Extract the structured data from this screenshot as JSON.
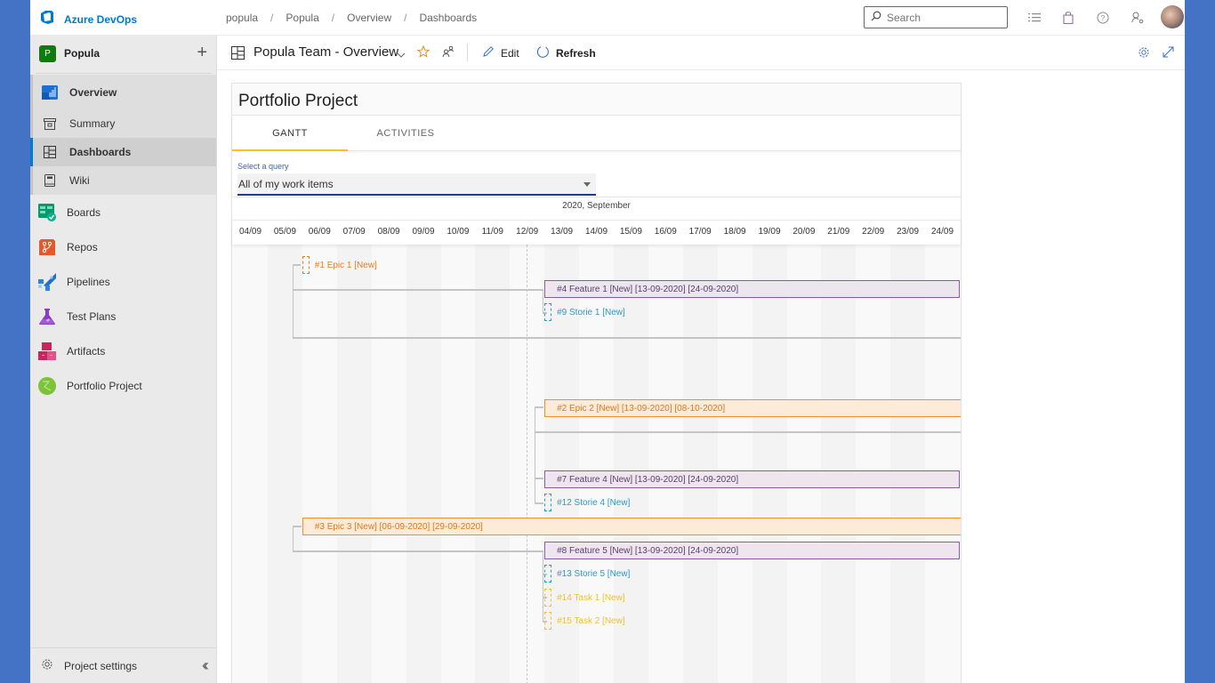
{
  "app": {
    "brand": "Azure DevOps",
    "accent": "#0078d4"
  },
  "breadcrumb": [
    "popula",
    "Popula",
    "Overview",
    "Dashboards"
  ],
  "search": {
    "placeholder": "Search"
  },
  "topbar_icons": [
    "list-icon",
    "shopping-bag-icon",
    "help-icon",
    "user-settings-icon"
  ],
  "sidebar": {
    "project": {
      "initial": "P",
      "name": "Popula",
      "color": "#107c10"
    },
    "overview_group": [
      {
        "label": "Overview",
        "icon": "overview-icon"
      },
      {
        "label": "Summary",
        "icon": "summary-icon"
      },
      {
        "label": "Dashboards",
        "icon": "dashboards-icon",
        "active": true
      },
      {
        "label": "Wiki",
        "icon": "wiki-icon"
      }
    ],
    "items": [
      {
        "label": "Boards",
        "icon": "boards-icon"
      },
      {
        "label": "Repos",
        "icon": "repos-icon"
      },
      {
        "label": "Pipelines",
        "icon": "pipelines-icon"
      },
      {
        "label": "Test Plans",
        "icon": "test-plans-icon"
      },
      {
        "label": "Artifacts",
        "icon": "artifacts-icon"
      },
      {
        "label": "Portfolio Project",
        "icon": "portfolio-icon"
      }
    ],
    "footer": {
      "label": "Project settings"
    }
  },
  "dashboard": {
    "title": "Popula Team - Overview",
    "edit_label": "Edit",
    "refresh_label": "Refresh"
  },
  "widget": {
    "title": "Portfolio Project",
    "tabs": [
      {
        "label": "GANTT",
        "active": true
      },
      {
        "label": "ACTIVITIES",
        "active": false
      }
    ],
    "query": {
      "label": "Select a query",
      "value": "All of my work items"
    },
    "gantt": {
      "month": "2020, September",
      "days": [
        "04/09",
        "05/09",
        "06/09",
        "07/09",
        "08/09",
        "09/09",
        "10/09",
        "11/09",
        "12/09",
        "13/09",
        "14/09",
        "15/09",
        "16/09",
        "17/09",
        "18/09",
        "19/09",
        "20/09",
        "21/09",
        "22/09",
        "23/09",
        "24/09"
      ],
      "today": "12/09",
      "items": [
        {
          "label": "#1 Epic 1 [New]",
          "type": "epic",
          "kind": "milestone",
          "start": "06/09"
        },
        {
          "label": "#4 Feature 1 [New] [13-09-2020] [24-09-2020]",
          "type": "feature",
          "kind": "bar",
          "start": "13/09",
          "end": "24/09"
        },
        {
          "label": "#9 Storie 1 [New]",
          "type": "story",
          "kind": "milestone",
          "start": "13/09"
        },
        {
          "label": "#2 Epic 2 [New] [13-09-2020] [08-10-2020]",
          "type": "epic",
          "kind": "bar",
          "start": "13/09",
          "end": "08/10"
        },
        {
          "label": "#7 Feature 4 [New] [13-09-2020] [24-09-2020]",
          "type": "feature",
          "kind": "bar",
          "start": "13/09",
          "end": "24/09"
        },
        {
          "label": "#12 Storie 4 [New]",
          "type": "story",
          "kind": "milestone",
          "start": "13/09"
        },
        {
          "label": "#3 Epic 3 [New] [06-09-2020] [29-09-2020]",
          "type": "epic",
          "kind": "bar",
          "start": "06/09",
          "end": "29/09"
        },
        {
          "label": "#8 Feature 5 [New] [13-09-2020] [24-09-2020]",
          "type": "feature",
          "kind": "bar",
          "start": "13/09",
          "end": "24/09"
        },
        {
          "label": "#13 Storie 5 [New]",
          "type": "story",
          "kind": "milestone",
          "start": "13/09"
        },
        {
          "label": "#14 Task 1 [New]",
          "type": "task",
          "kind": "milestone",
          "start": "13/09"
        },
        {
          "label": "#15 Task 2 [New]",
          "type": "task",
          "kind": "milestone",
          "start": "13/09"
        }
      ]
    }
  }
}
